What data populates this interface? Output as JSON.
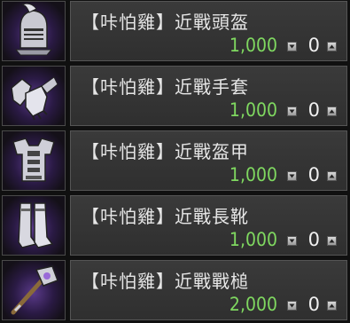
{
  "items": [
    {
      "name": "【咔怕雞】近戰頭盔",
      "price": "1,000",
      "qty": "0",
      "icon": "helmet-icon"
    },
    {
      "name": "【咔怕雞】近戰手套",
      "price": "1,000",
      "qty": "0",
      "icon": "gloves-icon"
    },
    {
      "name": "【咔怕雞】近戰盔甲",
      "price": "1,000",
      "qty": "0",
      "icon": "armor-icon"
    },
    {
      "name": "【咔怕雞】近戰長靴",
      "price": "1,000",
      "qty": "0",
      "icon": "boots-icon"
    },
    {
      "name": "【咔怕雞】近戰戰槌",
      "price": "2,000",
      "qty": "0",
      "icon": "hammer-icon"
    }
  ],
  "colors": {
    "price": "#7fd860",
    "name": "#e6e6e6",
    "panel": "#353535",
    "icon_glow": "#5a3a8a"
  }
}
